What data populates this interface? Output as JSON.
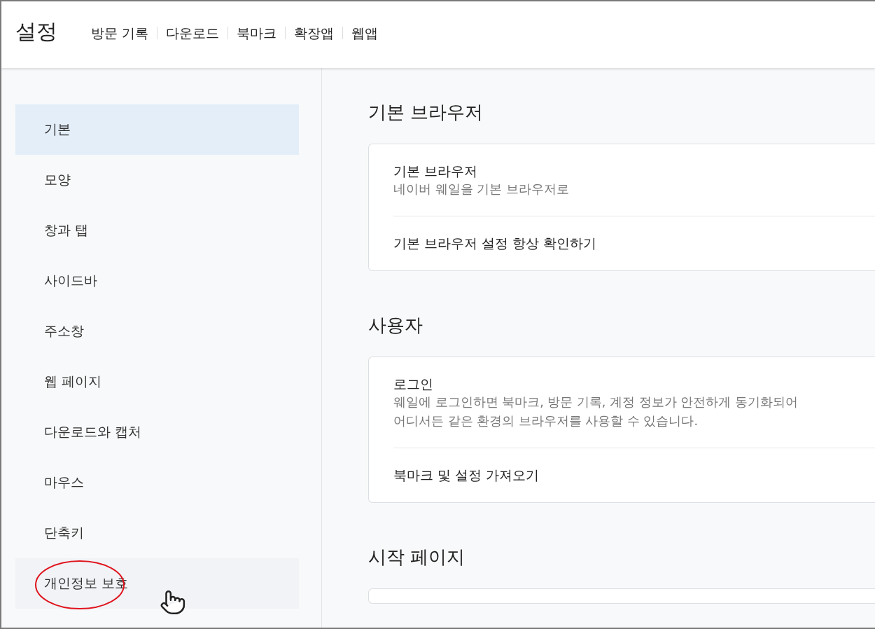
{
  "header": {
    "title": "설정",
    "nav": [
      {
        "label": "방문 기록"
      },
      {
        "label": "다운로드"
      },
      {
        "label": "북마크"
      },
      {
        "label": "확장앱"
      },
      {
        "label": "웹앱"
      }
    ]
  },
  "sidebar": {
    "items": [
      {
        "label": "기본",
        "selected": true,
        "hovered": false
      },
      {
        "label": "모양",
        "selected": false,
        "hovered": false
      },
      {
        "label": "창과 탭",
        "selected": false,
        "hovered": false
      },
      {
        "label": "사이드바",
        "selected": false,
        "hovered": false
      },
      {
        "label": "주소창",
        "selected": false,
        "hovered": false
      },
      {
        "label": "웹 페이지",
        "selected": false,
        "hovered": false
      },
      {
        "label": "다운로드와 캡처",
        "selected": false,
        "hovered": false
      },
      {
        "label": "마우스",
        "selected": false,
        "hovered": false
      },
      {
        "label": "단축키",
        "selected": false,
        "hovered": false
      },
      {
        "label": "개인정보 보호",
        "selected": false,
        "hovered": true,
        "circled": true
      }
    ]
  },
  "sections": [
    {
      "title": "기본 브라우저",
      "rows": [
        {
          "title": "기본 브라우저",
          "description": [
            "네이버 웨일을 기본 브라우저로"
          ]
        },
        {
          "title": "기본 브라우저 설정 항상 확인하기"
        }
      ]
    },
    {
      "title": "사용자",
      "rows": [
        {
          "title": "로그인",
          "description": [
            "웨일에 로그인하면 북마크, 방문 기록, 계정 정보가 안전하게 동기화되어",
            "어디서든 같은 환경의 브라우저를 사용할 수 있습니다."
          ]
        },
        {
          "title": "북마크 및 설정 가져오기"
        }
      ]
    },
    {
      "title": "시작 페이지"
    }
  ]
}
